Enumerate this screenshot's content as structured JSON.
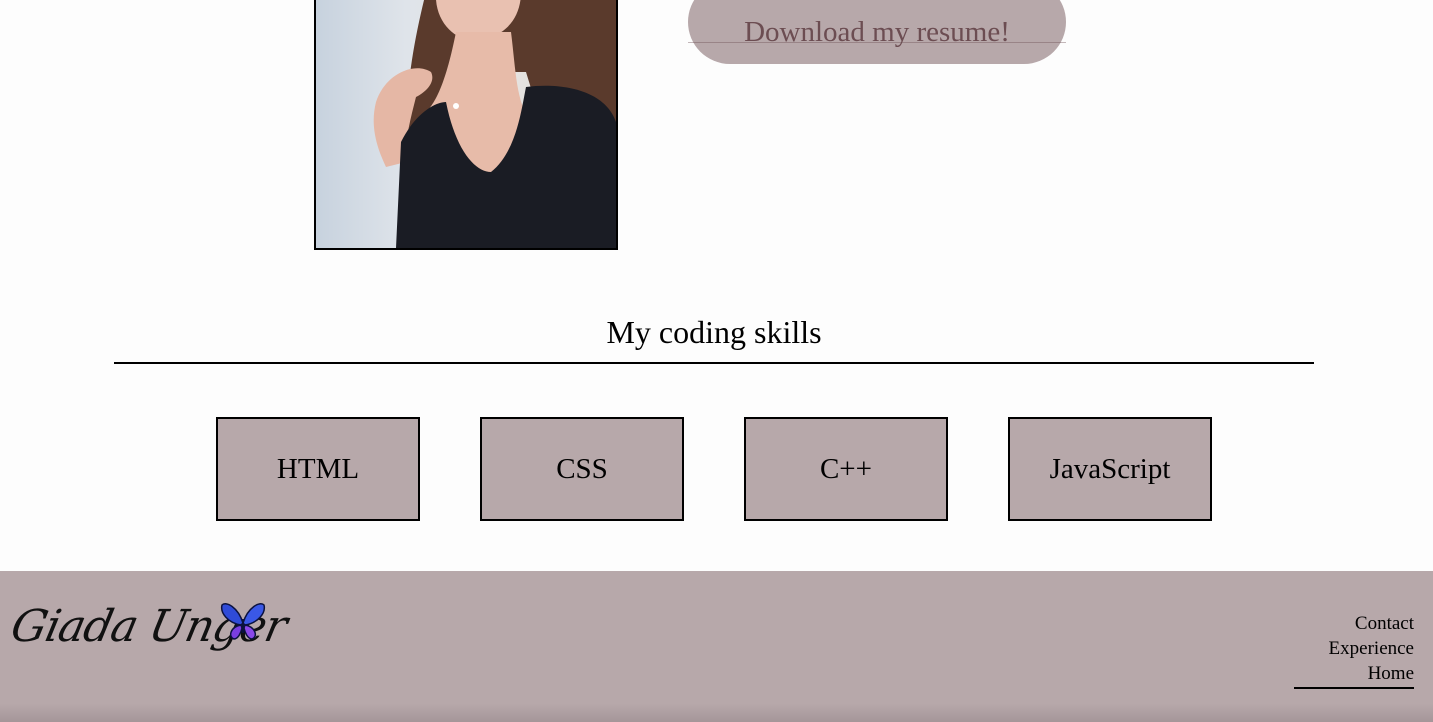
{
  "resume": {
    "label": "Download my resume!"
  },
  "skills": {
    "title": "My coding skills",
    "items": [
      "HTML",
      "CSS",
      "C++",
      "JavaScript"
    ]
  },
  "footer": {
    "signature": "Giada Unger",
    "nav": [
      "Contact",
      "Experience",
      "Home"
    ],
    "icon": "butterfly-icon"
  },
  "colors": {
    "accent": "#b7a8aa",
    "button_text": "#6c4d52",
    "background": "#fdfdfd"
  }
}
